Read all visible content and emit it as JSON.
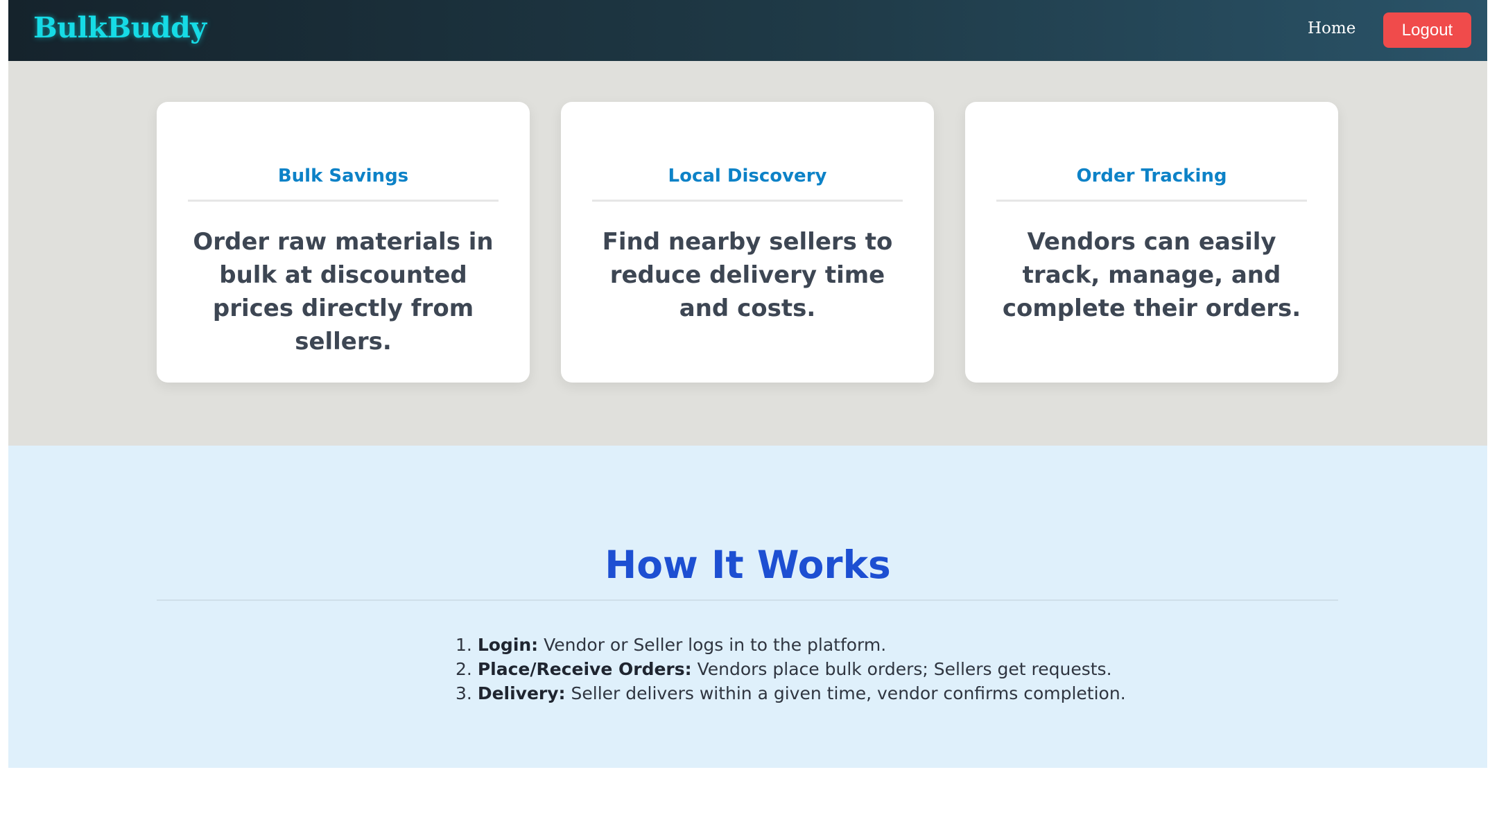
{
  "navbar": {
    "brand": "BulkBuddy",
    "home": "Home",
    "logout": "Logout"
  },
  "features": [
    {
      "title": "Bulk Savings",
      "text": "Order raw materials in bulk at discounted prices directly from sellers."
    },
    {
      "title": "Local Discovery",
      "text": "Find nearby sellers to reduce delivery time and costs."
    },
    {
      "title": "Order Tracking",
      "text": "Vendors can easily track, manage, and complete their orders."
    }
  ],
  "how_it_works": {
    "title": "How It Works",
    "steps": [
      {
        "num": "1.",
        "label": "Login:",
        "text": "Vendor or Seller logs in to the platform."
      },
      {
        "num": "2.",
        "label": "Place/Receive Orders:",
        "text": "Vendors place bulk orders; Sellers get requests."
      },
      {
        "num": "3.",
        "label": "Delivery:",
        "text": "Seller delivers within a given time, vendor confirms completion."
      }
    ]
  },
  "colors": {
    "navbar_start": "#15232c",
    "navbar_end": "#2a5368",
    "brand": "#16dbe6",
    "logout_button": "#f04b4b",
    "feature_bg": "#e0e0dc",
    "feature_title": "#0d82c7",
    "how_bg": "#dff0fb",
    "how_title": "#1d4fd2"
  }
}
